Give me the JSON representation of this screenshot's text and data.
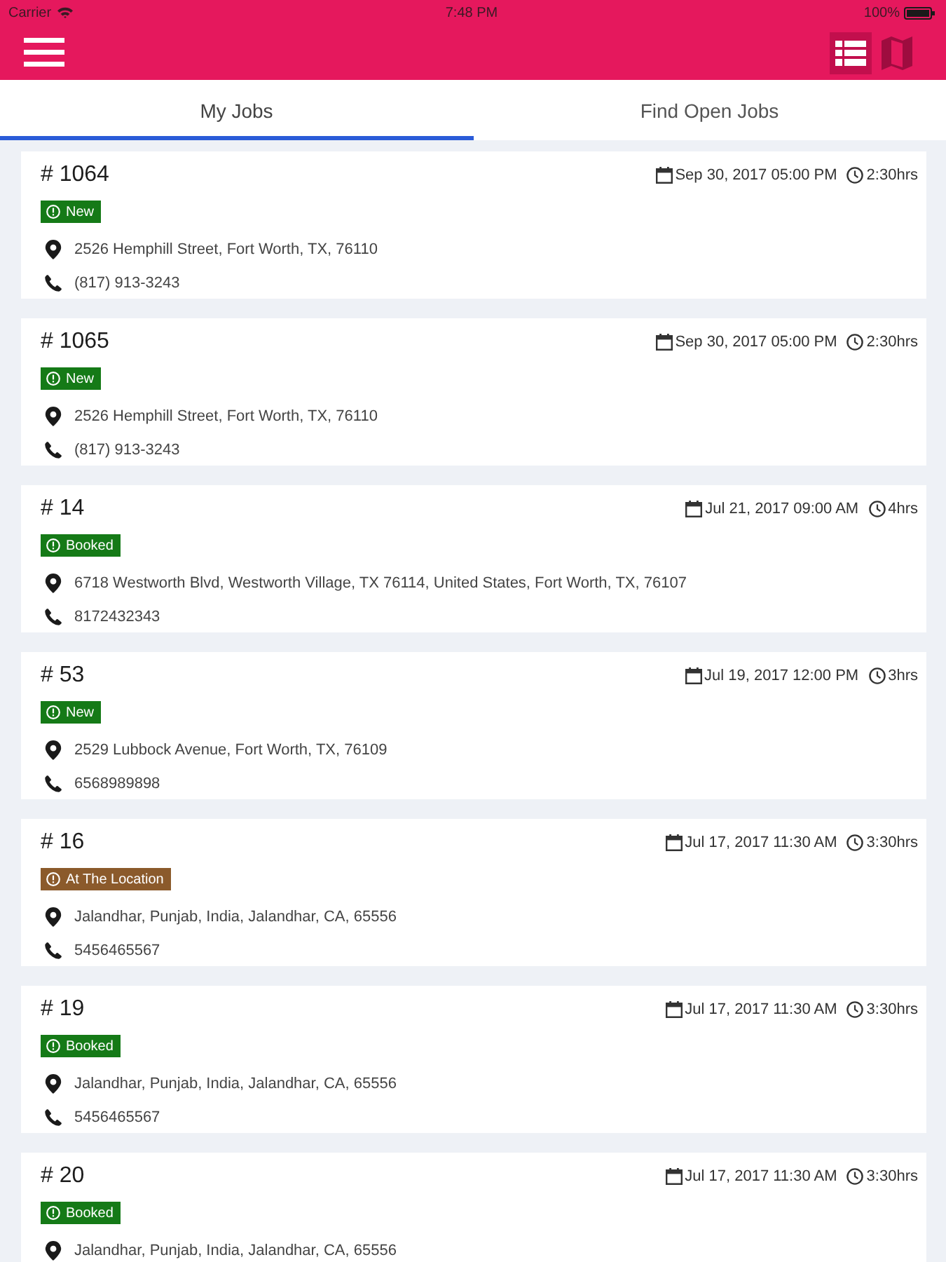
{
  "status_bar": {
    "carrier": "Carrier",
    "time": "7:48 PM",
    "battery": "100%"
  },
  "header": {
    "view_buttons": [
      {
        "kind": "list",
        "selected": true
      },
      {
        "kind": "map",
        "selected": false
      }
    ]
  },
  "tabs": [
    {
      "label": "My Jobs",
      "selected": true
    },
    {
      "label": "Find Open Jobs",
      "selected": false
    }
  ],
  "jobs": [
    {
      "number": "# 1064",
      "date": "Sep 30, 2017 05:00 PM",
      "duration": "2:30hrs",
      "status": {
        "label": "New",
        "color": "#157a17"
      },
      "address": "2526 Hemphill Street, Fort Worth, TX, 76110",
      "phone": "(817) 913-3243"
    },
    {
      "number": "# 1065",
      "date": "Sep 30, 2017 05:00 PM",
      "duration": "2:30hrs",
      "status": {
        "label": "New",
        "color": "#157a17"
      },
      "address": "2526 Hemphill Street, Fort Worth, TX, 76110",
      "phone": "(817) 913-3243"
    },
    {
      "number": "# 14",
      "date": "Jul 21, 2017 09:00 AM",
      "duration": "4hrs",
      "status": {
        "label": "Booked",
        "color": "#157a17"
      },
      "address": "6718 Westworth Blvd, Westworth Village, TX 76114, United States, Fort Worth, TX, 76107",
      "phone": "8172432343"
    },
    {
      "number": "# 53",
      "date": "Jul 19, 2017 12:00 PM",
      "duration": "3hrs",
      "status": {
        "label": "New",
        "color": "#157a17"
      },
      "address": "2529 Lubbock Avenue, Fort Worth, TX, 76109",
      "phone": "6568989898"
    },
    {
      "number": "# 16",
      "date": "Jul 17, 2017 11:30 AM",
      "duration": "3:30hrs",
      "status": {
        "label": "At The Location",
        "color": "#8b5a2b"
      },
      "address": "Jalandhar, Punjab, India, Jalandhar, CA, 65556",
      "phone": "5456465567"
    },
    {
      "number": "# 19",
      "date": "Jul 17, 2017 11:30 AM",
      "duration": "3:30hrs",
      "status": {
        "label": "Booked",
        "color": "#157a17"
      },
      "address": "Jalandhar, Punjab, India, Jalandhar, CA, 65556",
      "phone": "5456465567"
    },
    {
      "number": "# 20",
      "date": "Jul 17, 2017 11:30 AM",
      "duration": "3:30hrs",
      "status": {
        "label": "Booked",
        "color": "#157a17"
      },
      "address": "Jalandhar, Punjab, India, Jalandhar, CA, 65556"
    }
  ]
}
